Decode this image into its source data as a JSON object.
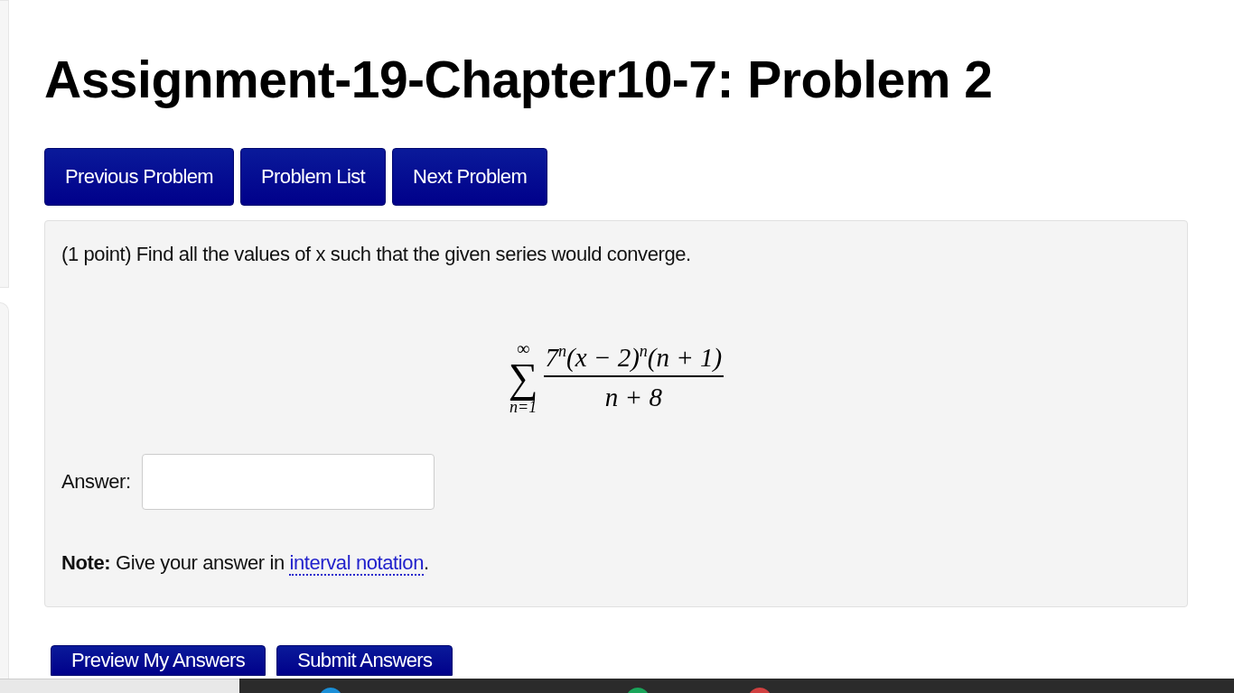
{
  "title": "Assignment-19-Chapter10-7: Problem 2",
  "nav_buttons": [
    "Previous Problem",
    "Problem List",
    "Next Problem"
  ],
  "problem": {
    "prompt": "(1 point) Find all the values of x such that the given series would converge.",
    "formula": {
      "sum_symbol": "∑",
      "upper": "∞",
      "lower": "n=1",
      "numerator": "7$^{n}$(x − 2)$^{n}$(n + 1)",
      "denominator": "n + 8"
    },
    "answer_label": "Answer:",
    "note": {
      "label": "Note:",
      "text": "Give your answer in",
      "link": "interval notation",
      "end": "."
    }
  },
  "action_buttons": [
    "Preview My Answers",
    "Submit Answers"
  ]
}
